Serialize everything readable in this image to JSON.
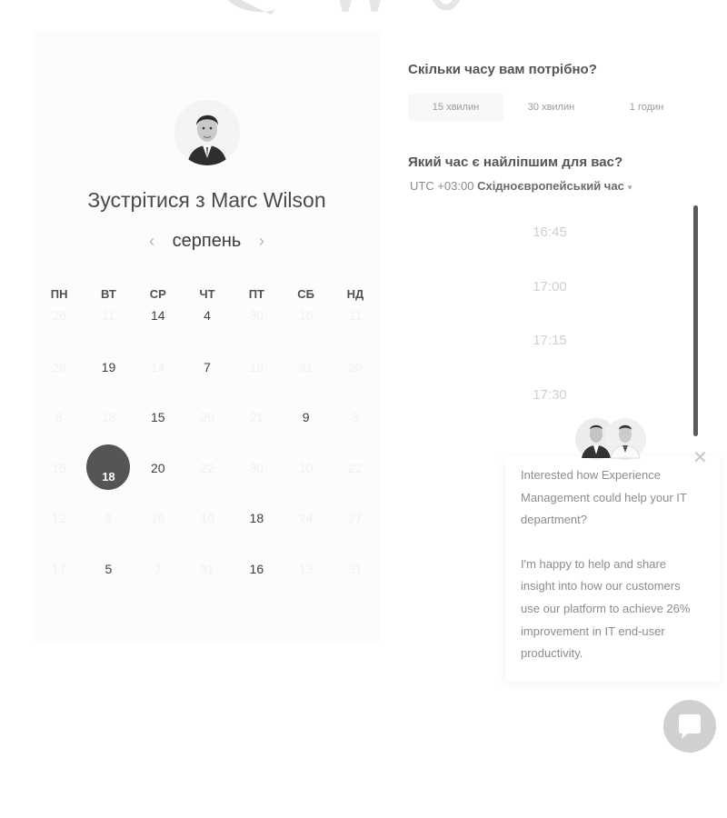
{
  "calendar": {
    "title": "Зустрітися з Marc Wilson",
    "month": "серпень",
    "weekdays": [
      "ПН",
      "ВТ",
      "СР",
      "ЧТ",
      "ПТ",
      "СБ",
      "НД"
    ],
    "days": [
      [
        "26",
        "11",
        "14",
        "4",
        "30",
        "16",
        "11"
      ],
      [
        "28",
        "19",
        "14",
        "7",
        "18",
        "31",
        "20"
      ],
      [
        "8",
        "18",
        "15",
        "20",
        "21",
        "9",
        "3"
      ],
      [
        "15",
        "18",
        "20",
        "22",
        "30",
        "10",
        "22"
      ],
      [
        "12",
        "3",
        "16",
        "10",
        "18",
        "24",
        "27"
      ],
      [
        "17",
        "5",
        "2",
        "31",
        "16",
        "13",
        "31"
      ]
    ],
    "available": [
      [
        0,
        2
      ],
      [
        0,
        3
      ],
      [
        1,
        1
      ],
      [
        1,
        3
      ],
      [
        2,
        2
      ],
      [
        2,
        5
      ],
      [
        3,
        2
      ],
      [
        4,
        4
      ],
      [
        5,
        1
      ],
      [
        5,
        4
      ]
    ],
    "selected": [
      3,
      1
    ]
  },
  "duration": {
    "question": "Скільки часу вам потрібно?",
    "options": [
      "15 хвилин",
      "30 хвилин",
      "1 годин"
    ],
    "selected_index": 0
  },
  "time": {
    "question": "Який час є найліпшим для вас?",
    "timezone_offset": "UTC +03:00",
    "timezone_name": "Східноєвропейський час",
    "slots": [
      "16:45",
      "17:00",
      "17:15",
      "17:30"
    ]
  },
  "chat_popup": {
    "paragraph1": "Interested how Experience Management could help your IT department?",
    "paragraph2": "I'm happy to help and share insight into how our customers use our platform to achieve 26% improvement in IT end-user productivity."
  },
  "icons": {
    "prev": "‹",
    "next": "›",
    "close": "✕",
    "caret": "▾"
  }
}
